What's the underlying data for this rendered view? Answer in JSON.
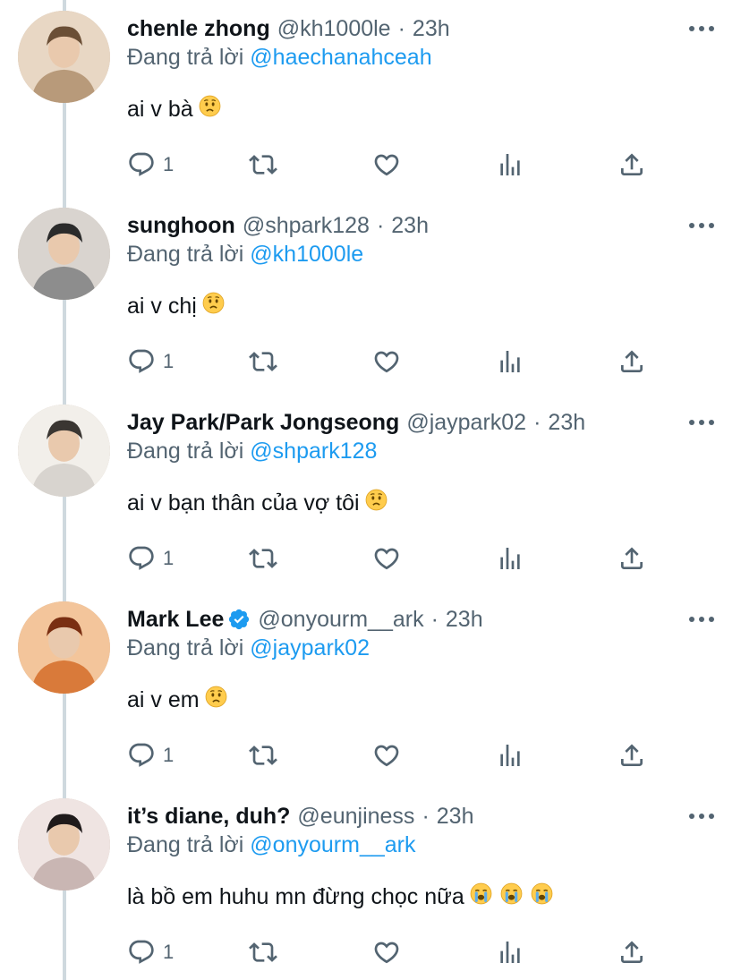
{
  "reply_prefix": "Đang trả lời",
  "tweets": [
    {
      "name": "chenle zhong",
      "handle": "@kh1000le",
      "time": "23h",
      "reply_to": "@haechanahceah",
      "text": "ai v bà",
      "emoji": [
        "worried-face"
      ],
      "reply_count": "1",
      "verified": false,
      "avatar_icon": "avatar-photo"
    },
    {
      "name": "sunghoon",
      "handle": "@shpark128",
      "time": "23h",
      "reply_to": "@kh1000le",
      "text": "ai v chị",
      "emoji": [
        "worried-face"
      ],
      "reply_count": "1",
      "verified": false,
      "avatar_icon": "avatar-photo"
    },
    {
      "name": "Jay Park/Park Jongseong",
      "handle": "@jaypark02",
      "time": "23h",
      "reply_to": "@shpark128",
      "text": "ai v bạn thân của vợ tôi",
      "emoji": [
        "worried-face"
      ],
      "reply_count": "1",
      "verified": false,
      "avatar_icon": "avatar-photo"
    },
    {
      "name": "Mark Lee",
      "handle": "@onyourm__ark",
      "time": "23h",
      "reply_to": "@jaypark02",
      "text": "ai v em",
      "emoji": [
        "worried-face"
      ],
      "reply_count": "1",
      "verified": true,
      "avatar_icon": "avatar-photo"
    },
    {
      "name": "it’s diane, duh?",
      "handle": "@eunjiness",
      "time": "23h",
      "reply_to": "@onyourm__ark",
      "text": "là bồ em huhu mn đừng chọc nữa",
      "emoji": [
        "loudly-crying-face",
        "loudly-crying-face",
        "loudly-crying-face"
      ],
      "reply_count": "1",
      "verified": false,
      "avatar_icon": "avatar-photo"
    }
  ],
  "icons": {
    "reply": "reply-icon",
    "retweet": "retweet-icon",
    "like": "heart-icon",
    "views": "analytics-icon",
    "share": "share-icon",
    "more": "more-options-icon"
  },
  "colors": {
    "link": "#1d9bf0",
    "secondary": "#536471",
    "primary": "#0f1419",
    "thread_line": "#cfd9de"
  }
}
